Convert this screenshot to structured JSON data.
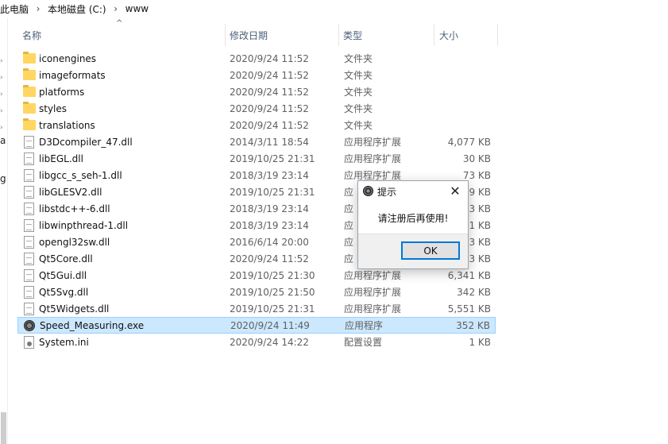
{
  "breadcrumb": {
    "items": [
      "此电脑",
      "本地磁盘 (C:)",
      "www"
    ],
    "separator": "›"
  },
  "nav_pane": {
    "partial_labels": [
      "a",
      "g"
    ]
  },
  "columns": {
    "name": "名称",
    "date": "修改日期",
    "type": "类型",
    "size": "大小",
    "sort_indicator": "^"
  },
  "files": [
    {
      "name": "iconengines",
      "date": "2020/9/24 11:52",
      "type": "文件夹",
      "size": "",
      "icon": "folder-icon"
    },
    {
      "name": "imageformats",
      "date": "2020/9/24 11:52",
      "type": "文件夹",
      "size": "",
      "icon": "folder-icon"
    },
    {
      "name": "platforms",
      "date": "2020/9/24 11:52",
      "type": "文件夹",
      "size": "",
      "icon": "folder-icon"
    },
    {
      "name": "styles",
      "date": "2020/9/24 11:52",
      "type": "文件夹",
      "size": "",
      "icon": "folder-icon"
    },
    {
      "name": "translations",
      "date": "2020/9/24 11:52",
      "type": "文件夹",
      "size": "",
      "icon": "folder-icon"
    },
    {
      "name": "D3Dcompiler_47.dll",
      "date": "2014/3/11 18:54",
      "type": "应用程序扩展",
      "size": "4,077 KB",
      "icon": "dll-file-icon"
    },
    {
      "name": "libEGL.dll",
      "date": "2019/10/25 21:31",
      "type": "应用程序扩展",
      "size": "30 KB",
      "icon": "dll-file-icon"
    },
    {
      "name": "libgcc_s_seh-1.dll",
      "date": "2018/3/19 23:14",
      "type": "应用程序扩展",
      "size": "73 KB",
      "icon": "dll-file-icon"
    },
    {
      "name": "libGLESV2.dll",
      "date": "2019/10/25 21:31",
      "type": "应",
      "size": "9 KB",
      "icon": "dll-file-icon"
    },
    {
      "name": "libstdc++-6.dll",
      "date": "2018/3/19 23:14",
      "type": "应",
      "size": "3 KB",
      "icon": "dll-file-icon"
    },
    {
      "name": "libwinpthread-1.dll",
      "date": "2018/3/19 23:14",
      "type": "应",
      "size": "1 KB",
      "icon": "dll-file-icon"
    },
    {
      "name": "opengl32sw.dll",
      "date": "2016/6/14 20:00",
      "type": "应",
      "size": "3 KB",
      "icon": "dll-file-icon"
    },
    {
      "name": "Qt5Core.dll",
      "date": "2020/9/24 11:52",
      "type": "应",
      "size": "3 KB",
      "icon": "dll-file-icon"
    },
    {
      "name": "Qt5Gui.dll",
      "date": "2019/10/25 21:30",
      "type": "应用程序扩展",
      "size": "6,341 KB",
      "icon": "dll-file-icon"
    },
    {
      "name": "Qt5Svg.dll",
      "date": "2019/10/25 21:50",
      "type": "应用程序扩展",
      "size": "342 KB",
      "icon": "dll-file-icon"
    },
    {
      "name": "Qt5Widgets.dll",
      "date": "2019/10/25 21:31",
      "type": "应用程序扩展",
      "size": "5,551 KB",
      "icon": "dll-file-icon"
    },
    {
      "name": "Speed_Measuring.exe",
      "date": "2020/9/24 11:49",
      "type": "应用程序",
      "size": "352 KB",
      "icon": "exe-gear-icon",
      "selected": true
    },
    {
      "name": "System.ini",
      "date": "2020/9/24 14:22",
      "type": "配置设置",
      "size": "1 KB",
      "icon": "ini-settings-icon"
    }
  ],
  "dialog": {
    "title": "提示",
    "message": "请注册后再使用!",
    "ok_label": "OK",
    "close_glyph": "✕"
  },
  "colors": {
    "selection_bg": "#cce8ff",
    "selection_border": "#99d1ff",
    "header_text": "#4c607a",
    "button_focus": "#0078d7",
    "folder": "#ffd661"
  }
}
